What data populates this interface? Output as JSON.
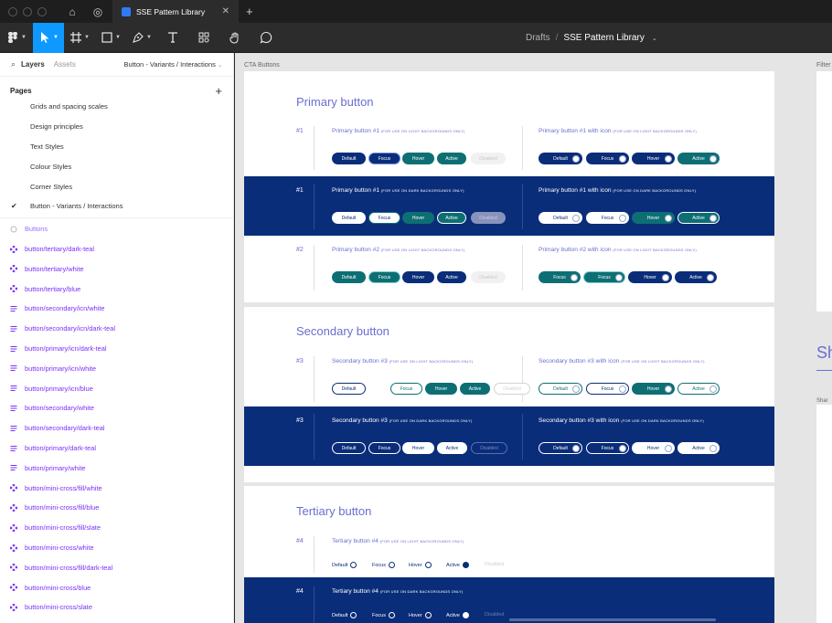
{
  "titlebar": {
    "tab_title": "SSE Pattern Library"
  },
  "toolbar": {
    "crumb_drafts": "Drafts",
    "crumb_sep": "/",
    "crumb_file": "SSE Pattern Library"
  },
  "sidebar": {
    "tab_layers": "Layers",
    "tab_assets": "Assets",
    "current_page": "Button - Variants / Interactions",
    "pages_heading": "Pages",
    "pages": [
      "Grids and spacing scales",
      "Design principles",
      "Text Styles",
      "Colour Styles",
      "Corner Styles",
      "Button - Variants / Interactions"
    ],
    "layers": [
      {
        "name": "Buttons",
        "kind": "frame"
      },
      {
        "name": "button/tertiary/dark-teal",
        "kind": "component"
      },
      {
        "name": "button/tertiary/white",
        "kind": "component"
      },
      {
        "name": "button/tertiary/blue",
        "kind": "component"
      },
      {
        "name": "button/secondary/icn/white",
        "kind": "text"
      },
      {
        "name": "button/secondary/icn/dark-teal",
        "kind": "text"
      },
      {
        "name": "button/primary/icn/dark-teal",
        "kind": "text"
      },
      {
        "name": "button/primary/icn/white",
        "kind": "text"
      },
      {
        "name": "button/primary/icn/blue",
        "kind": "text"
      },
      {
        "name": "button/secondary/white",
        "kind": "text"
      },
      {
        "name": "button/secondary/dark-teal",
        "kind": "text"
      },
      {
        "name": "button/primary/dark-teal",
        "kind": "text"
      },
      {
        "name": "button/primary/white",
        "kind": "text"
      },
      {
        "name": "button/mini-cross/fill/white",
        "kind": "component"
      },
      {
        "name": "button/mini-cross/fill/blue",
        "kind": "component"
      },
      {
        "name": "button/mini-cross/fill/slate",
        "kind": "component"
      },
      {
        "name": "button/mini-cross/white",
        "kind": "component"
      },
      {
        "name": "button/mini-cross/fill/dark-teal",
        "kind": "component"
      },
      {
        "name": "button/mini-cross/blue",
        "kind": "component"
      },
      {
        "name": "button/mini-cross/slate",
        "kind": "component"
      }
    ]
  },
  "canvas": {
    "frame_label": "CTA Buttons",
    "frame_label_right": "Filter",
    "right_heading": "Sh",
    "right_sub": "Shar",
    "sections": {
      "primary": "Primary button",
      "secondary": "Secondary button",
      "tertiary": "Tertiary button"
    },
    "nums": {
      "n1": "#1",
      "n2": "#2",
      "n3": "#3",
      "n4": "#4"
    },
    "labels": {
      "primary1": "Primary button #1",
      "primary1_icon": "Primary button #1 with icon",
      "primary2": "Primary button #2",
      "primary2_icon": "Primary button #2 with icon",
      "secondary3": "Secondary button #3",
      "secondary3_icon": "Secondary button #3 with icon",
      "tertiary4": "Tertiary button #4"
    },
    "notes": {
      "light": "(FOR USE ON LIGHT BACKGROUNDS ONLY)",
      "dark": "(FOR USE ON DARK BACKGROUNDS ONLY)"
    },
    "states": {
      "default": "Default",
      "focus": "Focus",
      "hover": "Hover",
      "active": "Active",
      "disabled": "Disabled"
    }
  },
  "colors": {
    "navy": "#0a2d7a",
    "teal": "#0d6f73",
    "accent": "#6b6ed0",
    "toolbar_active": "#0d99ff",
    "layer_purple": "#7b2ff7"
  }
}
